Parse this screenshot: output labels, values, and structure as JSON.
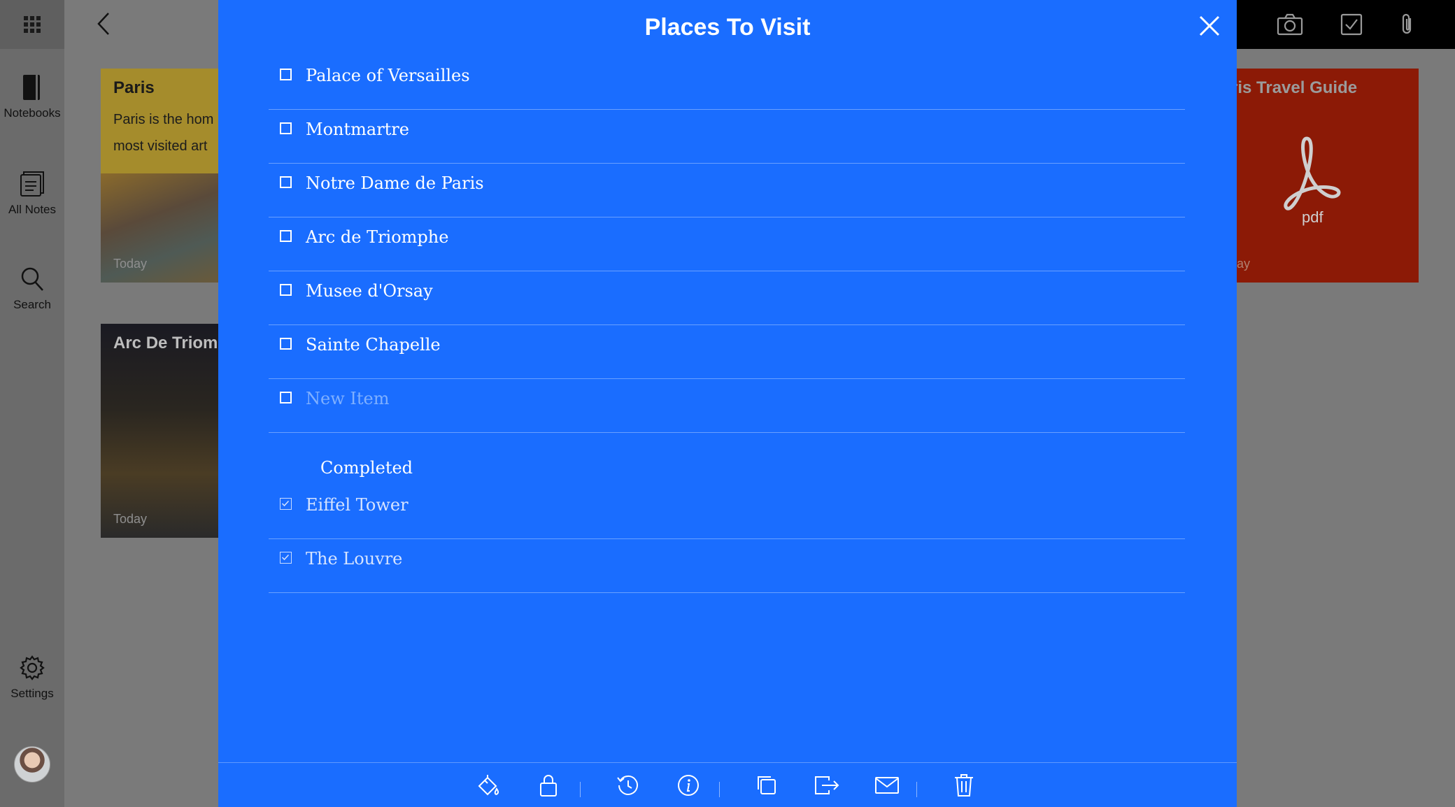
{
  "sidebar": {
    "items": [
      {
        "label": "Notebooks",
        "icon": "notebook-icon"
      },
      {
        "label": "All Notes",
        "icon": "all-notes-icon"
      },
      {
        "label": "Search",
        "icon": "search-icon"
      }
    ],
    "settings_label": "Settings"
  },
  "background_cards": {
    "paris": {
      "title": "Paris",
      "text_line1": "Paris is the hom",
      "text_line2": "most visited art",
      "date": "Today"
    },
    "arc": {
      "title": "Arc De Triom",
      "date": "Today"
    },
    "pdf": {
      "title": "ris Travel Guide",
      "file_label": "pdf",
      "date": "ay"
    }
  },
  "modal": {
    "title": "Places To Visit",
    "items": [
      {
        "label": "Palace of Versailles",
        "checked": false
      },
      {
        "label": "Montmartre",
        "checked": false
      },
      {
        "label": "Notre Dame de Paris",
        "checked": false
      },
      {
        "label": "Arc de Triomphe",
        "checked": false
      },
      {
        "label": "Musee d'Orsay",
        "checked": false
      },
      {
        "label": "Sainte Chapelle",
        "checked": false
      }
    ],
    "new_item_placeholder": "New Item",
    "completed_heading": "Completed",
    "completed_items": [
      {
        "label": "Eiffel Tower",
        "checked": true
      },
      {
        "label": "The Louvre",
        "checked": true
      }
    ],
    "toolbar": [
      "paint-bucket-icon",
      "lock-icon",
      "history-icon",
      "info-icon",
      "duplicate-icon",
      "move-icon",
      "email-icon",
      "trash-icon"
    ]
  },
  "colors": {
    "modal_background": "#1a6dff",
    "overlay": "#7a7a7a"
  }
}
